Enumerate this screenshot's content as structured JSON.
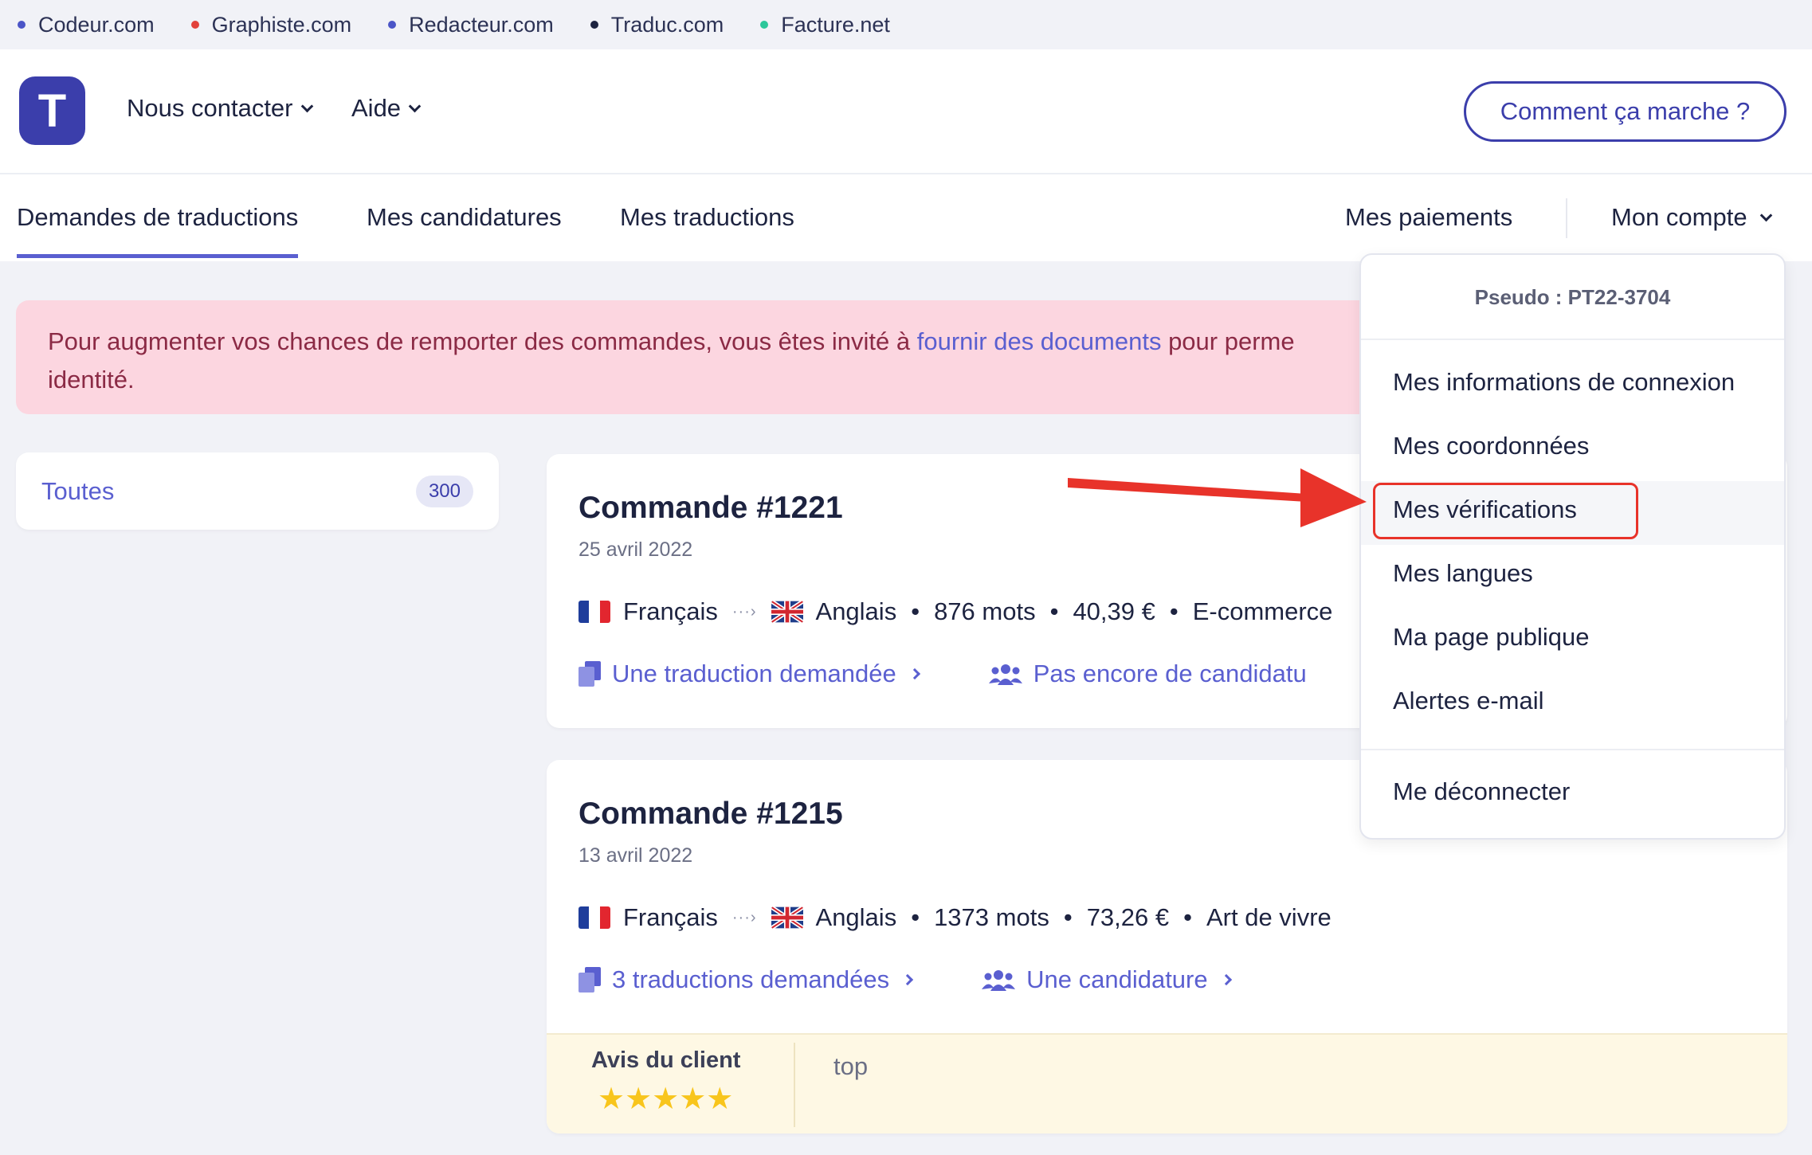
{
  "network": {
    "sites": [
      {
        "label": "Codeur.com",
        "color": "#4b55c7"
      },
      {
        "label": "Graphiste.com",
        "color": "#e2423b"
      },
      {
        "label": "Redacteur.com",
        "color": "#4b55c7"
      },
      {
        "label": "Traduc.com",
        "color": "#1d2340"
      },
      {
        "label": "Facture.net",
        "color": "#2cc79a"
      }
    ]
  },
  "header": {
    "logo_letter": "T",
    "nav": [
      "Nous contacter",
      "Aide"
    ],
    "how_button": "Comment ça marche ?"
  },
  "tabs": {
    "left": [
      "Demandes de traductions",
      "Mes candidatures",
      "Mes traductions"
    ],
    "payments": "Mes paiements",
    "account": "Mon compte"
  },
  "alert": {
    "before": "Pour augmenter vos chances de remporter des commandes, vous êtes invité à ",
    "link": "fournir des documents",
    "after": " pour perme",
    "line2": "identité."
  },
  "filter": {
    "label": "Toutes",
    "count": "300"
  },
  "orders": [
    {
      "title": "Commande #1221",
      "date": "25 avril 2022",
      "source_lang": "Français",
      "target_lang": "Anglais",
      "words": "876 mots",
      "price": "40,39 €",
      "category": "E-commerce",
      "translations_link": "Une traduction demandée",
      "candidates_link": "Pas encore de candidatu"
    },
    {
      "title": "Commande #1215",
      "date": "13 avril 2022",
      "source_lang": "Français",
      "target_lang": "Anglais",
      "words": "1373 mots",
      "price": "73,26 €",
      "category": "Art de vivre",
      "translations_link": "3 traductions demandées",
      "candidates_link": "Une candidature",
      "review_label": "Avis du client",
      "review_stars": "★★★★★",
      "review_rating": 5,
      "review_text": "top"
    }
  ],
  "account_menu": {
    "pseudo": "Pseudo : PT22-3704",
    "items": [
      "Mes informations de connexion",
      "Mes coordonnées",
      "Mes vérifications",
      "Mes langues",
      "Ma page publique",
      "Alertes e-mail"
    ],
    "logout": "Me déconnecter",
    "highlighted": "Mes vérifications"
  },
  "colors": {
    "brand": "#3b3eab",
    "accent": "#5a5fd0",
    "annotation": "#e8332a"
  }
}
